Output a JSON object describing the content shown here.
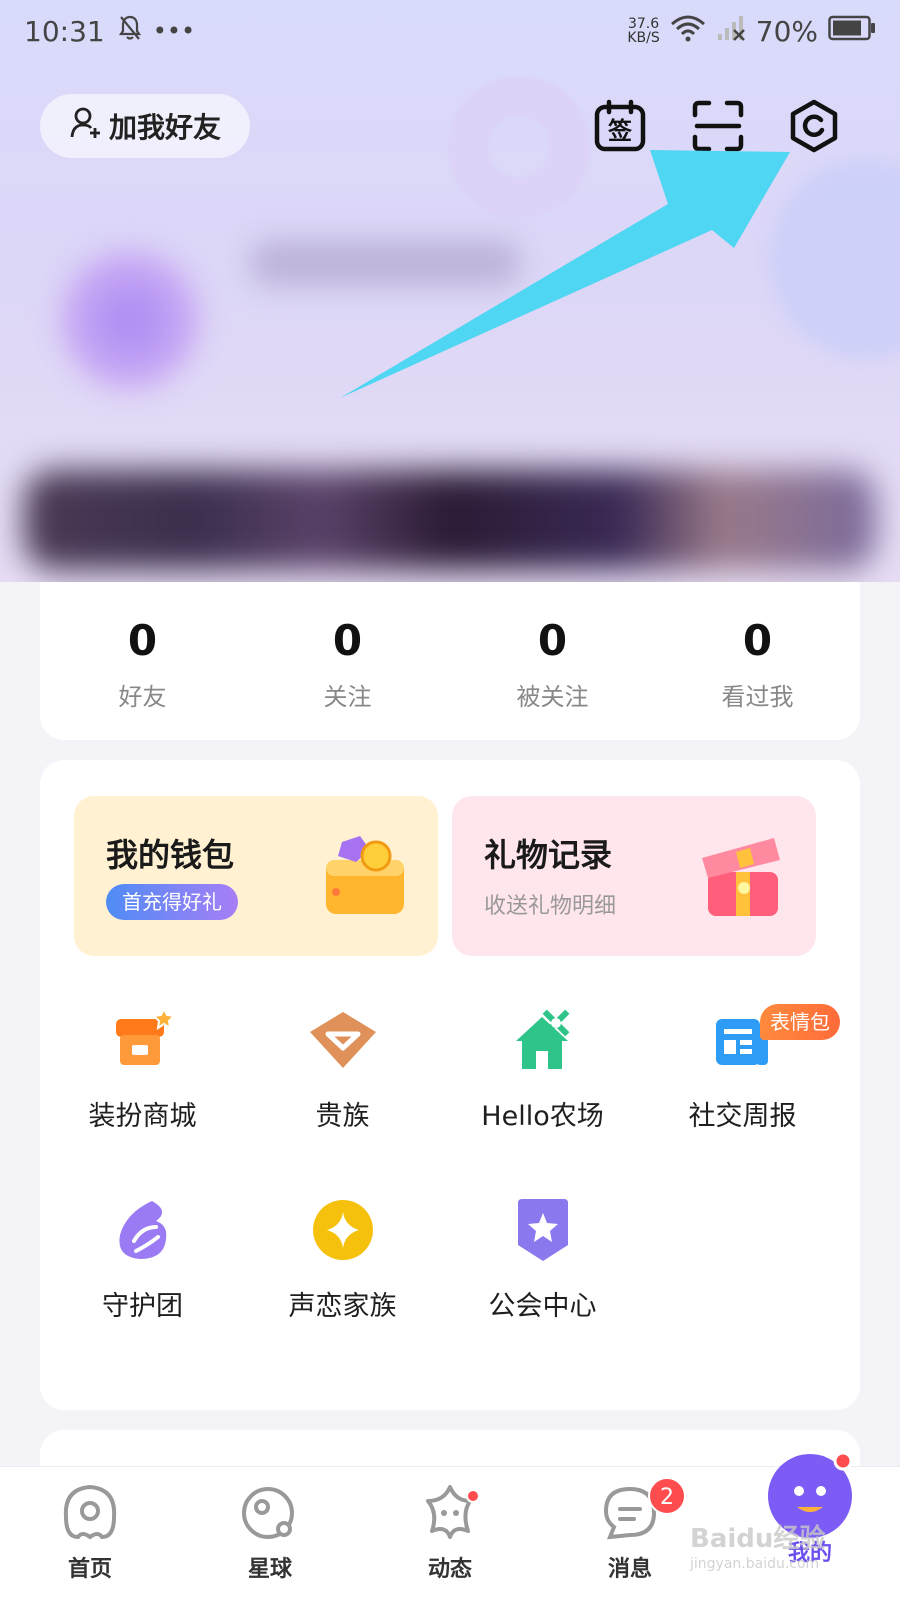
{
  "status_bar": {
    "time": "10:31",
    "speed_value": "37.6",
    "speed_unit": "KB/S",
    "battery": "70%"
  },
  "header": {
    "add_friend_label": "加我好友",
    "sign_icon_label": "签"
  },
  "stats": [
    {
      "value": "0",
      "label": "好友"
    },
    {
      "value": "0",
      "label": "关注"
    },
    {
      "value": "0",
      "label": "被关注"
    },
    {
      "value": "0",
      "label": "看过我"
    }
  ],
  "features": {
    "wallet": {
      "title": "我的钱包",
      "promo": "首充得好礼"
    },
    "gifts": {
      "title": "礼物记录",
      "subtitle": "收送礼物明细"
    }
  },
  "menu": {
    "row1": [
      {
        "label": "装扮商城",
        "icon": "shop-icon"
      },
      {
        "label": "贵族",
        "icon": "noble-icon"
      },
      {
        "label": "Hello农场",
        "icon": "farm-icon"
      },
      {
        "label": "社交周报",
        "icon": "weekly-report-icon",
        "tag": "表情包"
      }
    ],
    "row2": [
      {
        "label": "守护团",
        "icon": "guard-icon"
      },
      {
        "label": "声恋家族",
        "icon": "family-icon"
      },
      {
        "label": "公会中心",
        "icon": "guild-icon"
      }
    ]
  },
  "bottom_nav": [
    {
      "label": "首页"
    },
    {
      "label": "星球"
    },
    {
      "label": "动态"
    },
    {
      "label": "消息",
      "badge": "2"
    },
    {
      "label": "我的"
    }
  ],
  "watermark": {
    "brand": "Baidu经验",
    "url": "jingyan.baidu.com"
  },
  "colors": {
    "accent": "#6d4ff0",
    "arrow": "#4fd6f2",
    "badge": "#ff4d4f"
  }
}
